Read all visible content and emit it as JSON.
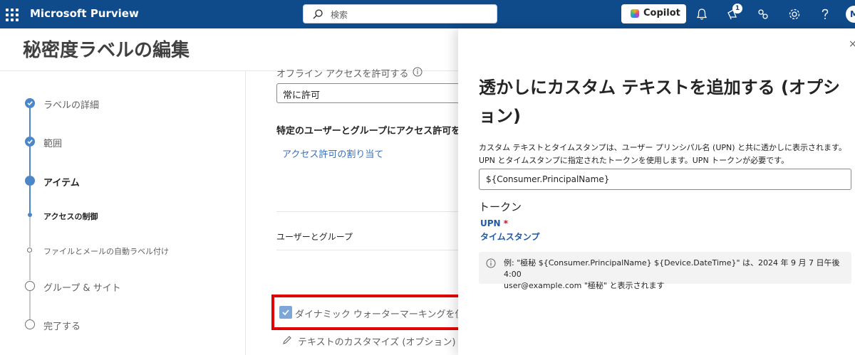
{
  "topbar": {
    "app_title": "Microsoft Purview",
    "search_placeholder": "検索",
    "copilot_label": "Copilot",
    "notification_badge": "1",
    "avatar_initial": "M"
  },
  "page": {
    "title": "秘密度ラベルの編集"
  },
  "stepper": {
    "steps": [
      {
        "label": "ラベルの詳細",
        "state": "done"
      },
      {
        "label": "範囲",
        "state": "done"
      },
      {
        "label": "アイテム",
        "state": "current"
      },
      {
        "label": "アクセスの制御",
        "state": "current-sub"
      },
      {
        "label": "ファイルとメールの自動ラベル付け",
        "state": "sub"
      },
      {
        "label": "グループ & サイト",
        "state": "todo"
      },
      {
        "label": "完了する",
        "state": "todo"
      }
    ]
  },
  "form": {
    "offline_label": "オフライン アクセスを許可する",
    "offline_value": "常に許可",
    "specific_users_label": "特定のユーザーとグループにアクセス許可を",
    "assign_link": "アクセス許可の割り当て",
    "users_groups_header": "ユーザーとグループ",
    "dynamic_watermark_label": "ダイナミック ウォーターマーキングを使",
    "dynamic_watermark_checked": true,
    "customize_text_link": "テキストのカスタマイズ (オプション)"
  },
  "panel": {
    "title": "透かしにカスタム テキストを追加する (オプション)",
    "description_line1": "カスタム テキストとタイムスタンプは、ユーザー プリンシパル名 (UPN) と共に透かしに表示されます。",
    "description_line2": "UPN とタイムスタンプに指定されたトークンを使用します。UPN トークンが必要です。",
    "input_value": "${Consumer.PrincipalName}",
    "tokens_header": "トークン",
    "token_upn": "UPN",
    "required_mark": "*",
    "token_timestamp": "タイムスタンプ",
    "info_line1": "例: \"極秘 ${Consumer.PrincipalName} ${Device.DateTime}\" は、2024 年 9 月 7 日午後 4:00",
    "info_line2": "user@example.com \"極秘\" と表示されます",
    "close_glyph": "×"
  },
  "colors": {
    "topbar": "#0f4a8a",
    "accent": "#4a86c8",
    "link": "#1f5aa6",
    "highlight": "#e10000"
  },
  "icons": [
    "waffle-icon",
    "search-icon",
    "copilot-icon",
    "bell-icon",
    "megaphone-icon",
    "share-icon",
    "gear-icon",
    "help-icon",
    "info-icon",
    "checkmark-icon",
    "pencil-icon",
    "close-icon"
  ]
}
